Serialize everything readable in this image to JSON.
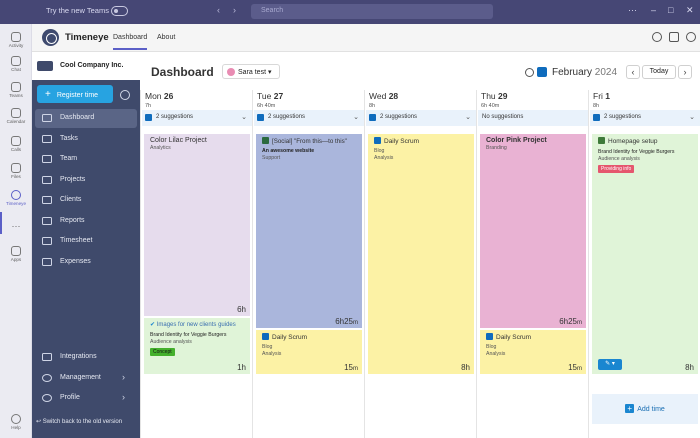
{
  "teams": {
    "try_new": "Try the new Teams",
    "search_placeholder": "Search",
    "more": "···",
    "win_min": "–",
    "win_max": "□",
    "win_close": "✕"
  },
  "rail": [
    {
      "label": "Activity",
      "icon": "bell-icon"
    },
    {
      "label": "Chat",
      "icon": "chat-icon"
    },
    {
      "label": "Teams",
      "icon": "teams-icon"
    },
    {
      "label": "Calendar",
      "icon": "calendar-icon"
    },
    {
      "label": "Calls",
      "icon": "phone-icon"
    },
    {
      "label": "Files",
      "icon": "file-icon"
    },
    {
      "label": "Timeneye",
      "icon": "timeneye-icon"
    },
    {
      "label": "···",
      "icon": "more-icon"
    },
    {
      "label": "Apps",
      "icon": "apps-icon"
    },
    {
      "label": "Help",
      "icon": "help-icon"
    }
  ],
  "app": {
    "name": "Timeneye",
    "tabs": [
      "Dashboard",
      "About"
    ]
  },
  "sidebar": {
    "company": "Cool Company Inc.",
    "register": "Register time",
    "register_plus": "+",
    "items": [
      "Dashboard",
      "Tasks",
      "Team",
      "Projects",
      "Clients",
      "Reports",
      "Timesheet",
      "Expenses"
    ],
    "bottom_items": [
      "Integrations",
      "Management",
      "Profile"
    ],
    "chev": "›",
    "switch": "Switch back to the old version"
  },
  "header": {
    "title": "Dashboard",
    "user": "Sara test",
    "user_caret": "▾",
    "month": "February",
    "year": "2024",
    "prev": "‹",
    "next": "›",
    "today": "Today"
  },
  "days": [
    {
      "dow": "Mon",
      "num": "26",
      "hours": "7h",
      "sug": "2 suggestions",
      "events": [
        {
          "title": "Color Lilac Project",
          "sub": "Analytics",
          "dur": "6h"
        },
        {
          "title": "Images for new clients guides",
          "bold": "Brand Identity for Veggie Burgers",
          "sub": "Audience analysis",
          "tag": "Concept",
          "dur": "1h"
        }
      ]
    },
    {
      "dow": "Tue",
      "num": "27",
      "hours": "6h 40m",
      "sug": "2 suggestions",
      "events": [
        {
          "title": "[Social] \"From this—to this\"",
          "bold": "An awesome website",
          "sub": "Support",
          "dur": "6h25",
          "unit": "m"
        },
        {
          "title": "Daily Scrum",
          "sub": "Blog",
          "sub2": "Analysis",
          "dur": "15",
          "unit": "m"
        }
      ]
    },
    {
      "dow": "Wed",
      "num": "28",
      "hours": "8h",
      "sug": "2 suggestions",
      "events": [
        {
          "title": "Daily Scrum",
          "sub": "Blog",
          "sub2": "Analysis",
          "dur": "8h"
        }
      ]
    },
    {
      "dow": "Thu",
      "num": "29",
      "hours": "6h 40m",
      "sug": "No suggestions",
      "events": [
        {
          "title": "Color Pink Project",
          "sub": "Branding",
          "dur": "6h25",
          "unit": "m"
        },
        {
          "title": "Daily Scrum",
          "sub": "Blog",
          "sub2": "Analysis",
          "dur": "15",
          "unit": "m"
        }
      ]
    },
    {
      "dow": "Fri",
      "num": "1",
      "hours": "8h",
      "sug": "2 suggestions",
      "events": [
        {
          "title": "Homepage setup",
          "bold": "Brand Identity for Veggie Burgers",
          "sub": "Audience analysis",
          "tag": "Providing info",
          "dur": "8h"
        }
      ],
      "add": "Add time"
    }
  ],
  "colors": {
    "lilac": "#e6dced",
    "blue": "#aab6dc",
    "yellow": "#fcf2a5",
    "pink": "#e9b2d3",
    "green": "#e0f4d8",
    "accent": "#27a3e1",
    "sidebar": "#3f4a6b"
  }
}
